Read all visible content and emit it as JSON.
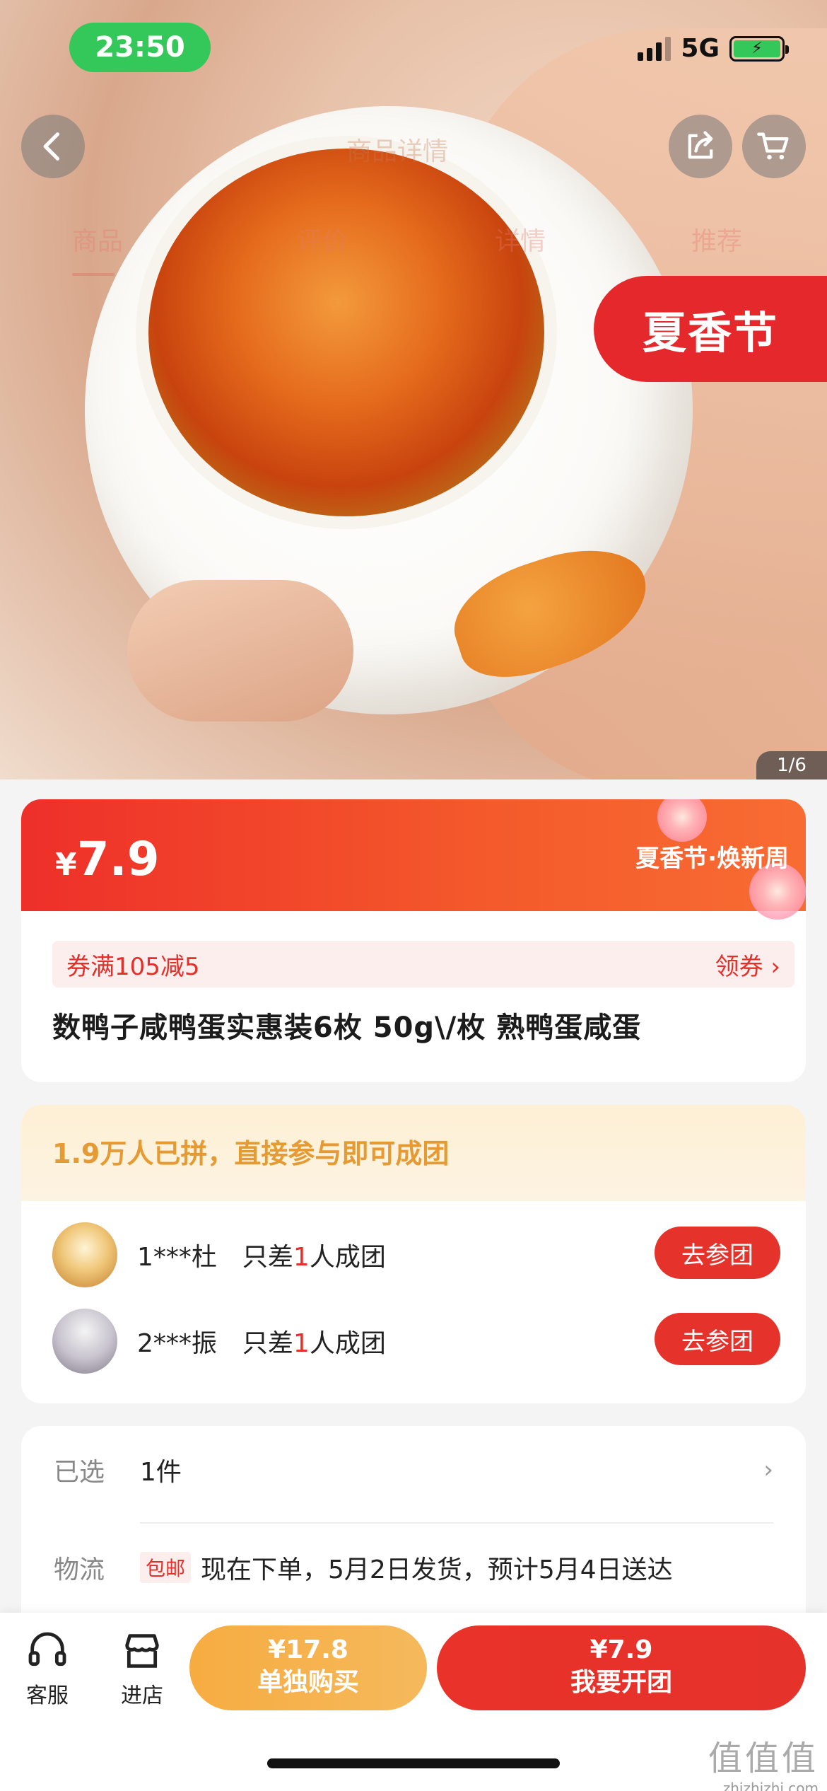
{
  "status_bar": {
    "time": "23:50",
    "network": "5G"
  },
  "hero": {
    "header_title": "商品详情",
    "tabs": [
      "商品",
      "评价",
      "详情",
      "推荐"
    ],
    "festival_tag": "夏香节",
    "image_counter": "1/6"
  },
  "price_card": {
    "currency": "¥",
    "price": "7.9",
    "promo_label": "夏香节·焕新周",
    "coupon_text": "券满105减5",
    "coupon_action": "领券",
    "product_title": "数鸭子咸鸭蛋实惠装6枚 50g\\/枚 熟鸭蛋咸蛋"
  },
  "group_buy": {
    "headline": "1.9万人已拼，直接参与即可成团",
    "groups": [
      {
        "name": "1***杜",
        "need_prefix": "只差",
        "need_count": "1",
        "need_suffix": "人成团",
        "button": "去参团"
      },
      {
        "name": "2***振",
        "need_prefix": "只差",
        "need_count": "1",
        "need_suffix": "人成团",
        "button": "去参团"
      }
    ]
  },
  "spec": {
    "selected_label": "已选",
    "selected_value": "1件",
    "shipping_label": "物流",
    "shipping_badge": "包邮",
    "shipping_text": "现在下单，5月2日发货，预计5月4日送达"
  },
  "bottom_bar": {
    "service_label": "客服",
    "store_label": "进店",
    "buy_alone_price": "¥17.8",
    "buy_alone_label": "单独购买",
    "buy_group_price": "¥7.9",
    "buy_group_label": "我要开团"
  },
  "watermark": {
    "logo": "值值值",
    "site": "zhizhizhi.com"
  },
  "colors": {
    "accent_red": "#e5322b",
    "accent_orange": "#f5b95c",
    "status_green": "#34c759"
  }
}
